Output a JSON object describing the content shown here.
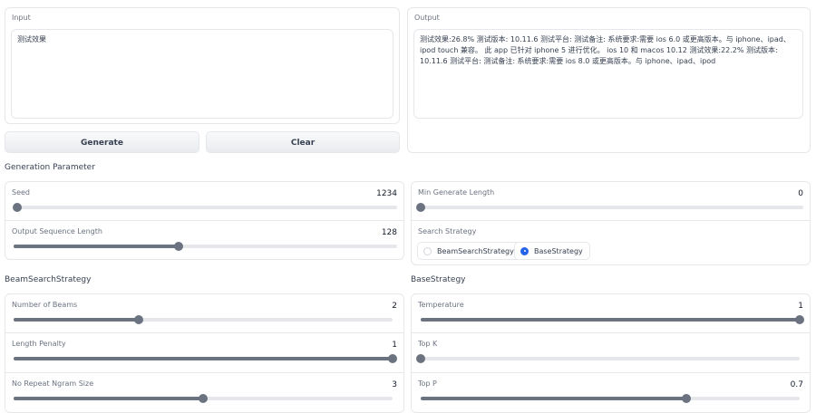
{
  "io": {
    "input_label": "Input",
    "input_value": "测试效果",
    "output_label": "Output",
    "output_value": "测试效果:26.8% 测试版本: 10.11.6 测试平台: 测试备注: 系统要求:需要 ios 6.0 或更高版本。与 iphone、ipad、ipod touch 兼容。 此 app 已针对 iphone 5 进行优化。 ios 10 和 macos 10.12 测试效果:22.2% 测试版本: 10.11.6 测试平台: 测试备注: 系统要求:需要 ios 8.0 或更高版本。与 iphone、ipad、ipod",
    "generate_label": "Generate",
    "clear_label": "Clear"
  },
  "generation": {
    "title": "Generation Parameter",
    "seed": {
      "label": "Seed",
      "value": "1234",
      "fraction": 0.01
    },
    "output_len": {
      "label": "Output Sequence Length",
      "value": "128",
      "fraction": 0.43
    },
    "min_len": {
      "label": "Min Generate Length",
      "value": "0",
      "fraction": 0.0
    },
    "search_strategy": {
      "label": "Search Strategy",
      "options": [
        "BeamSearchStrategy",
        "BaseStrategy"
      ],
      "selected": "BaseStrategy"
    }
  },
  "beam": {
    "title": "BeamSearchStrategy",
    "num_beams": {
      "label": "Number of Beams",
      "value": "2",
      "fraction": 0.33
    },
    "length_penalty": {
      "label": "Length Penalty",
      "value": "1",
      "fraction": 1.0
    },
    "no_repeat": {
      "label": "No Repeat Ngram Size",
      "value": "3",
      "fraction": 0.5
    }
  },
  "base": {
    "title": "BaseStrategy",
    "temperature": {
      "label": "Temperature",
      "value": "1",
      "fraction": 1.0
    },
    "top_k": {
      "label": "Top K",
      "value": "",
      "fraction": 0.0
    },
    "top_p": {
      "label": "Top P",
      "value": "0.7",
      "fraction": 0.7
    }
  }
}
